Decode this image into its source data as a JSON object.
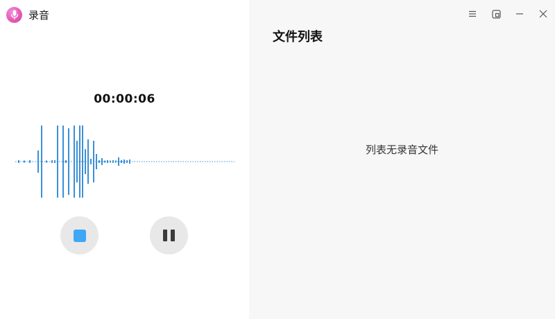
{
  "app": {
    "title": "录音",
    "icon": "microphone-icon",
    "accent_color": "#e55bb6"
  },
  "recorder": {
    "elapsed_time": "00:00:06",
    "waveform_color": "#3a8fd6",
    "stop_button_icon": "stop-icon",
    "stop_color": "#3fa7f5",
    "pause_button_icon": "pause-icon"
  },
  "file_list": {
    "title": "文件列表",
    "empty_message": "列表无录音文件"
  },
  "titlebar": {
    "buttons": [
      "menu-icon",
      "window-mode-icon",
      "minimize-icon",
      "close-icon"
    ]
  }
}
